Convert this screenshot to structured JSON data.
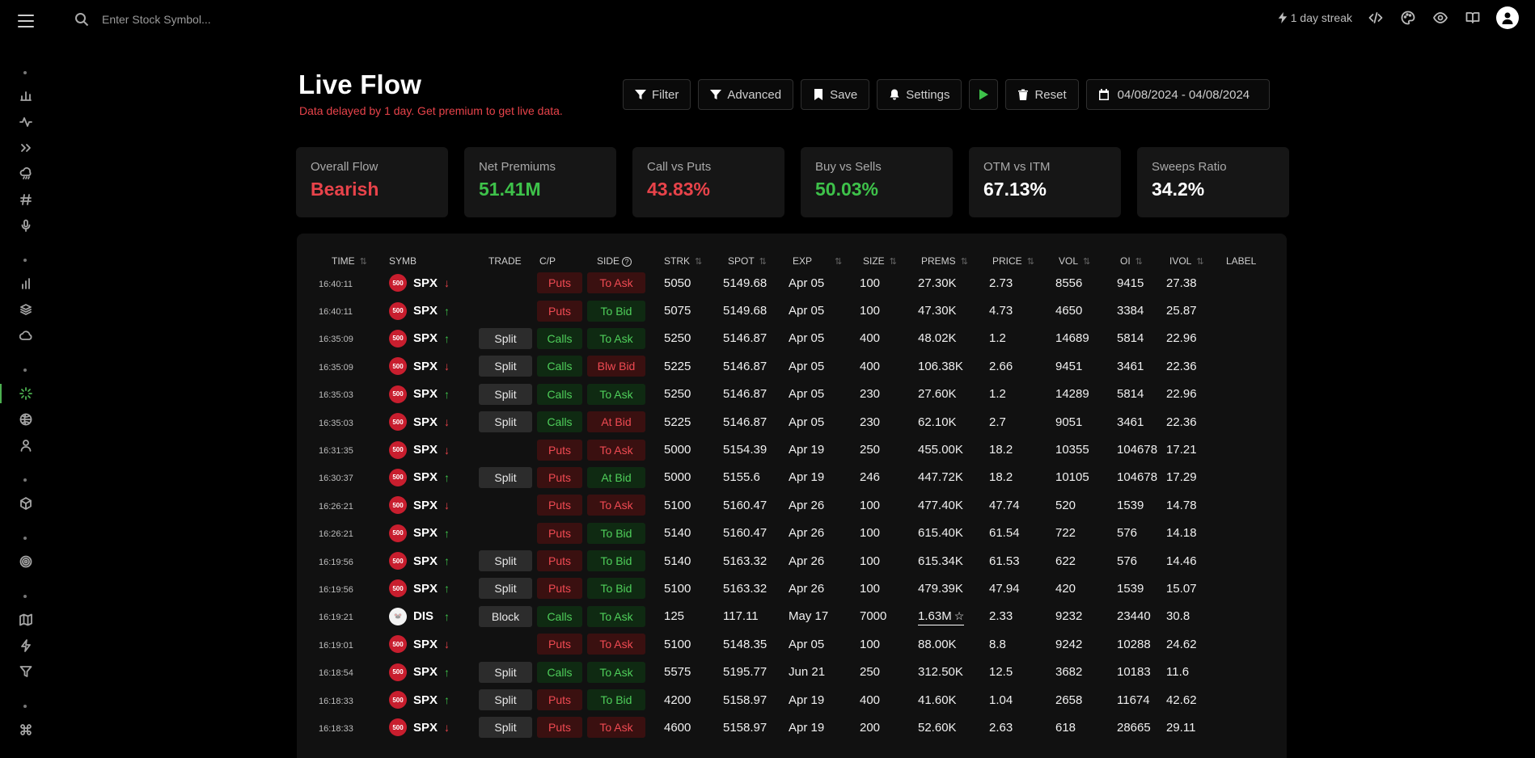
{
  "search": {
    "placeholder": "Enter Stock Symbol..."
  },
  "topbar": {
    "streak_label": "1 day streak"
  },
  "header": {
    "title": "Live Flow",
    "delay_note": "Data delayed by 1 day. Get premium to get live data."
  },
  "toolbar": {
    "filter_label": "Filter",
    "advanced_label": "Advanced",
    "save_label": "Save",
    "settings_label": "Settings",
    "reset_label": "Reset",
    "date_range": "04/08/2024 - 04/08/2024"
  },
  "colors": {
    "accent_green": "#3ec24a",
    "accent_red": "#e8434a",
    "background": "#000000",
    "card_bg": "#161616"
  },
  "stats": [
    {
      "label": "Overall Flow",
      "value": "Bearish",
      "color": "#e8434a"
    },
    {
      "label": "Net Premiums",
      "value": "51.41M",
      "color": "#3ec24a"
    },
    {
      "label": "Call vs Puts",
      "value": "43.83%",
      "color": "#e8434a"
    },
    {
      "label": "Buy vs Sells",
      "value": "50.03%",
      "color": "#3ec24a"
    },
    {
      "label": "OTM vs ITM",
      "value": "67.13%",
      "color": "#ffffff"
    },
    {
      "label": "Sweeps Ratio",
      "value": "34.2%",
      "color": "#ffffff"
    }
  ],
  "table": {
    "headers": {
      "time": "TIME",
      "symb": "SYMB",
      "trade": "TRADE",
      "cp": "C/P",
      "side": "SIDE",
      "strk": "STRK",
      "spot": "SPOT",
      "exp": "EXP",
      "size": "SIZE",
      "prems": "PREMS",
      "price": "PRICE",
      "vol": "VOL",
      "oi": "OI",
      "ivol": "IVOL",
      "label": "LABEL"
    },
    "rows": [
      {
        "time": "16:40:11",
        "logo": "500",
        "symbol": "SPX",
        "dir": "down",
        "trade": "",
        "cp": "Puts",
        "side": "To Ask",
        "side_color": "red",
        "strk": "5050",
        "spot": "5149.68",
        "exp": "Apr 05",
        "size": "100",
        "prems": "27.30K",
        "price": "2.73",
        "vol": "8556",
        "oi": "9415",
        "ivol": "27.38"
      },
      {
        "time": "16:40:11",
        "logo": "500",
        "symbol": "SPX",
        "dir": "up",
        "trade": "",
        "cp": "Puts",
        "side": "To Bid",
        "side_color": "green",
        "strk": "5075",
        "spot": "5149.68",
        "exp": "Apr 05",
        "size": "100",
        "prems": "47.30K",
        "price": "4.73",
        "vol": "4650",
        "oi": "3384",
        "ivol": "25.87"
      },
      {
        "time": "16:35:09",
        "logo": "500",
        "symbol": "SPX",
        "dir": "up",
        "trade": "Split",
        "cp": "Calls",
        "side": "To Ask",
        "side_color": "green",
        "strk": "5250",
        "spot": "5146.87",
        "exp": "Apr 05",
        "size": "400",
        "prems": "48.02K",
        "price": "1.2",
        "vol": "14689",
        "oi": "5814",
        "ivol": "22.96"
      },
      {
        "time": "16:35:09",
        "logo": "500",
        "symbol": "SPX",
        "dir": "down",
        "trade": "Split",
        "cp": "Calls",
        "side": "Blw Bid",
        "side_color": "red",
        "strk": "5225",
        "spot": "5146.87",
        "exp": "Apr 05",
        "size": "400",
        "prems": "106.38K",
        "price": "2.66",
        "vol": "9451",
        "oi": "3461",
        "ivol": "22.36"
      },
      {
        "time": "16:35:03",
        "logo": "500",
        "symbol": "SPX",
        "dir": "up",
        "trade": "Split",
        "cp": "Calls",
        "side": "To Ask",
        "side_color": "green",
        "strk": "5250",
        "spot": "5146.87",
        "exp": "Apr 05",
        "size": "230",
        "prems": "27.60K",
        "price": "1.2",
        "vol": "14289",
        "oi": "5814",
        "ivol": "22.96"
      },
      {
        "time": "16:35:03",
        "logo": "500",
        "symbol": "SPX",
        "dir": "down",
        "trade": "Split",
        "cp": "Calls",
        "side": "At Bid",
        "side_color": "red",
        "strk": "5225",
        "spot": "5146.87",
        "exp": "Apr 05",
        "size": "230",
        "prems": "62.10K",
        "price": "2.7",
        "vol": "9051",
        "oi": "3461",
        "ivol": "22.36"
      },
      {
        "time": "16:31:35",
        "logo": "500",
        "symbol": "SPX",
        "dir": "down",
        "trade": "",
        "cp": "Puts",
        "side": "To Ask",
        "side_color": "red",
        "strk": "5000",
        "spot": "5154.39",
        "exp": "Apr 19",
        "size": "250",
        "prems": "455.00K",
        "price": "18.2",
        "vol": "10355",
        "oi": "104678",
        "ivol": "17.21"
      },
      {
        "time": "16:30:37",
        "logo": "500",
        "symbol": "SPX",
        "dir": "up",
        "trade": "Split",
        "cp": "Puts",
        "side": "At Bid",
        "side_color": "green",
        "strk": "5000",
        "spot": "5155.6",
        "exp": "Apr 19",
        "size": "246",
        "prems": "447.72K",
        "price": "18.2",
        "vol": "10105",
        "oi": "104678",
        "ivol": "17.29"
      },
      {
        "time": "16:26:21",
        "logo": "500",
        "symbol": "SPX",
        "dir": "down",
        "trade": "",
        "cp": "Puts",
        "side": "To Ask",
        "side_color": "red",
        "strk": "5100",
        "spot": "5160.47",
        "exp": "Apr 26",
        "size": "100",
        "prems": "477.40K",
        "price": "47.74",
        "vol": "520",
        "oi": "1539",
        "ivol": "14.78"
      },
      {
        "time": "16:26:21",
        "logo": "500",
        "symbol": "SPX",
        "dir": "up",
        "trade": "",
        "cp": "Puts",
        "side": "To Bid",
        "side_color": "green",
        "strk": "5140",
        "spot": "5160.47",
        "exp": "Apr 26",
        "size": "100",
        "prems": "615.40K",
        "price": "61.54",
        "vol": "722",
        "oi": "576",
        "ivol": "14.18"
      },
      {
        "time": "16:19:56",
        "logo": "500",
        "symbol": "SPX",
        "dir": "up",
        "trade": "Split",
        "cp": "Puts",
        "side": "To Bid",
        "side_color": "green",
        "strk": "5140",
        "spot": "5163.32",
        "exp": "Apr 26",
        "size": "100",
        "prems": "615.34K",
        "price": "61.53",
        "vol": "622",
        "oi": "576",
        "ivol": "14.46"
      },
      {
        "time": "16:19:56",
        "logo": "500",
        "symbol": "SPX",
        "dir": "up",
        "trade": "Split",
        "cp": "Puts",
        "side": "To Bid",
        "side_color": "green",
        "strk": "5100",
        "spot": "5163.32",
        "exp": "Apr 26",
        "size": "100",
        "prems": "479.39K",
        "price": "47.94",
        "vol": "420",
        "oi": "1539",
        "ivol": "15.07"
      },
      {
        "time": "16:19:21",
        "logo": "DIS",
        "symbol": "DIS",
        "dir": "up",
        "trade": "Block",
        "cp": "Calls",
        "side": "To Ask",
        "side_color": "green",
        "strk": "125",
        "spot": "117.11",
        "exp": "May 17",
        "size": "7000",
        "prems": "1.63M",
        "starred": true,
        "price": "2.33",
        "vol": "9232",
        "oi": "23440",
        "ivol": "30.8"
      },
      {
        "time": "16:19:01",
        "logo": "500",
        "symbol": "SPX",
        "dir": "down",
        "trade": "",
        "cp": "Puts",
        "side": "To Ask",
        "side_color": "red",
        "strk": "5100",
        "spot": "5148.35",
        "exp": "Apr 05",
        "size": "100",
        "prems": "88.00K",
        "price": "8.8",
        "vol": "9242",
        "oi": "10288",
        "ivol": "24.62"
      },
      {
        "time": "16:18:54",
        "logo": "500",
        "symbol": "SPX",
        "dir": "up",
        "trade": "Split",
        "cp": "Calls",
        "side": "To Ask",
        "side_color": "green",
        "strk": "5575",
        "spot": "5195.77",
        "exp": "Jun 21",
        "size": "250",
        "prems": "312.50K",
        "price": "12.5",
        "vol": "3682",
        "oi": "10183",
        "ivol": "11.6"
      },
      {
        "time": "16:18:33",
        "logo": "500",
        "symbol": "SPX",
        "dir": "up",
        "trade": "Split",
        "cp": "Puts",
        "side": "To Bid",
        "side_color": "green",
        "strk": "4200",
        "spot": "5158.97",
        "exp": "Apr 19",
        "size": "400",
        "prems": "41.60K",
        "price": "1.04",
        "vol": "2658",
        "oi": "11674",
        "ivol": "42.62"
      },
      {
        "time": "16:18:33",
        "logo": "500",
        "symbol": "SPX",
        "dir": "down",
        "trade": "Split",
        "cp": "Puts",
        "side": "To Ask",
        "side_color": "red",
        "strk": "4600",
        "spot": "5158.97",
        "exp": "Apr 19",
        "size": "200",
        "prems": "52.60K",
        "price": "2.63",
        "vol": "618",
        "oi": "28665",
        "ivol": "29.11"
      }
    ]
  }
}
